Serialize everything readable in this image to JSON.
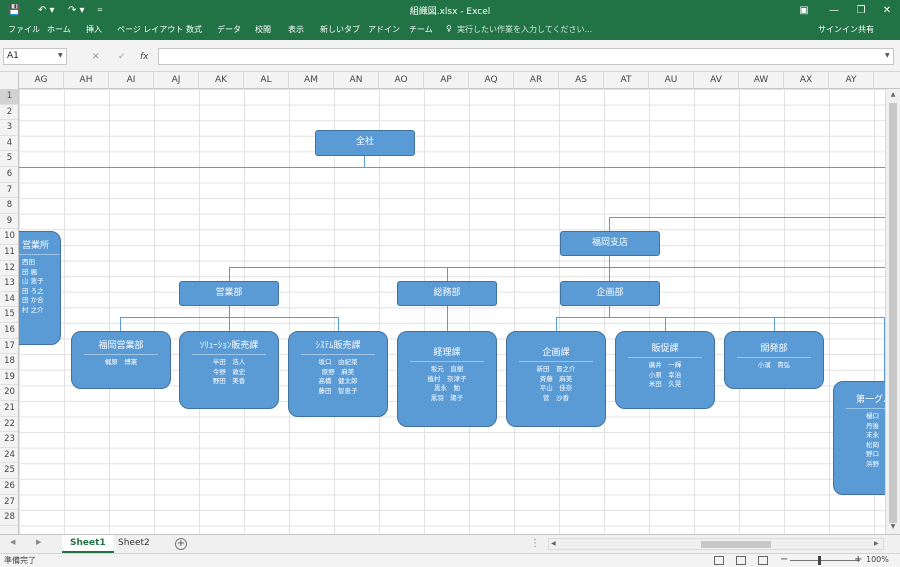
{
  "titlebar": {
    "title": "組織図.xlsx - Excel",
    "save_icon": "save-icon",
    "undo_icon": "undo-icon",
    "redo_icon": "redo-icon",
    "customize_icon": "customize-qat-icon"
  },
  "ribbon": {
    "tabs": [
      "ファイル",
      "ホーム",
      "挿入",
      "ページ レイアウト",
      "数式",
      "データ",
      "校閲",
      "表示",
      "新しいタブ",
      "アドイン",
      "チーム"
    ],
    "tell_me": "実行したい作業を入力してください...",
    "signin": "サインイン",
    "share": "共有"
  },
  "formula_bar": {
    "name_box": "A1",
    "cancel": "✕",
    "enter": "✓",
    "fx": "fx",
    "value": ""
  },
  "columns": [
    "AG",
    "AH",
    "AI",
    "AJ",
    "AK",
    "AL",
    "AM",
    "AN",
    "AO",
    "AP",
    "AQ",
    "AR",
    "AS",
    "AT",
    "AU",
    "AV",
    "AW",
    "AX",
    "AY"
  ],
  "rows": [
    "1",
    "2",
    "3",
    "4",
    "5",
    "6",
    "7",
    "8",
    "9",
    "10",
    "11",
    "12",
    "13",
    "14",
    "15",
    "16",
    "17",
    "18",
    "19",
    "20",
    "21",
    "22",
    "23",
    "24",
    "25",
    "26",
    "27",
    "28"
  ],
  "org": {
    "root": "全社",
    "branch": "福岡支店",
    "left_partial": {
      "name": "営業所",
      "members": [
        "西田",
        "田 楓",
        "山 恵子",
        "田 ろ之",
        "田 か合",
        "村 之介"
      ]
    },
    "divisions": {
      "sales": "営業部",
      "general": "総務部",
      "planning": "企画部",
      "dev": "開発部"
    },
    "sections": {
      "fukuoka_sales": {
        "name": "福岡営業部",
        "members": [
          "梶原　博憲"
        ]
      },
      "solution": {
        "name": "ｿﾘｭｰｼｮﾝ販売課",
        "members": [
          "半田　浩人",
          "今野　敦史",
          "野田　美香"
        ]
      },
      "system": {
        "name": "ｼｽﾃﾑ販売課",
        "members": [
          "坂口　由紀菜",
          "原野　麻美",
          "高橋　健太郎",
          "藤田　智恵子"
        ]
      },
      "accounting": {
        "name": "経理課",
        "members": [
          "坂元　直樹",
          "植村　奈津子",
          "黒永　勉",
          "黒羽　陽子"
        ]
      },
      "planning_sec": {
        "name": "企画課",
        "members": [
          "新田　晋之介",
          "斉藤　麻美",
          "平山　佳奈",
          "菅　沙香"
        ]
      },
      "promo": {
        "name": "販促課",
        "members": [
          "廣井　一輝",
          "小原　幸治",
          "米田　久晃"
        ]
      },
      "dev_sec": {
        "name": "開発部",
        "members": [
          "小濱　貴弘"
        ]
      },
      "first_group": {
        "name": "第一グル",
        "members": [
          "樋口",
          "丹後　明",
          "末永",
          "松岡",
          "野口",
          "浜野"
        ]
      }
    }
  },
  "sheets": [
    "Sheet1",
    "Sheet2"
  ],
  "active_sheet": "Sheet1",
  "status": "準備完了",
  "zoom": "100%"
}
